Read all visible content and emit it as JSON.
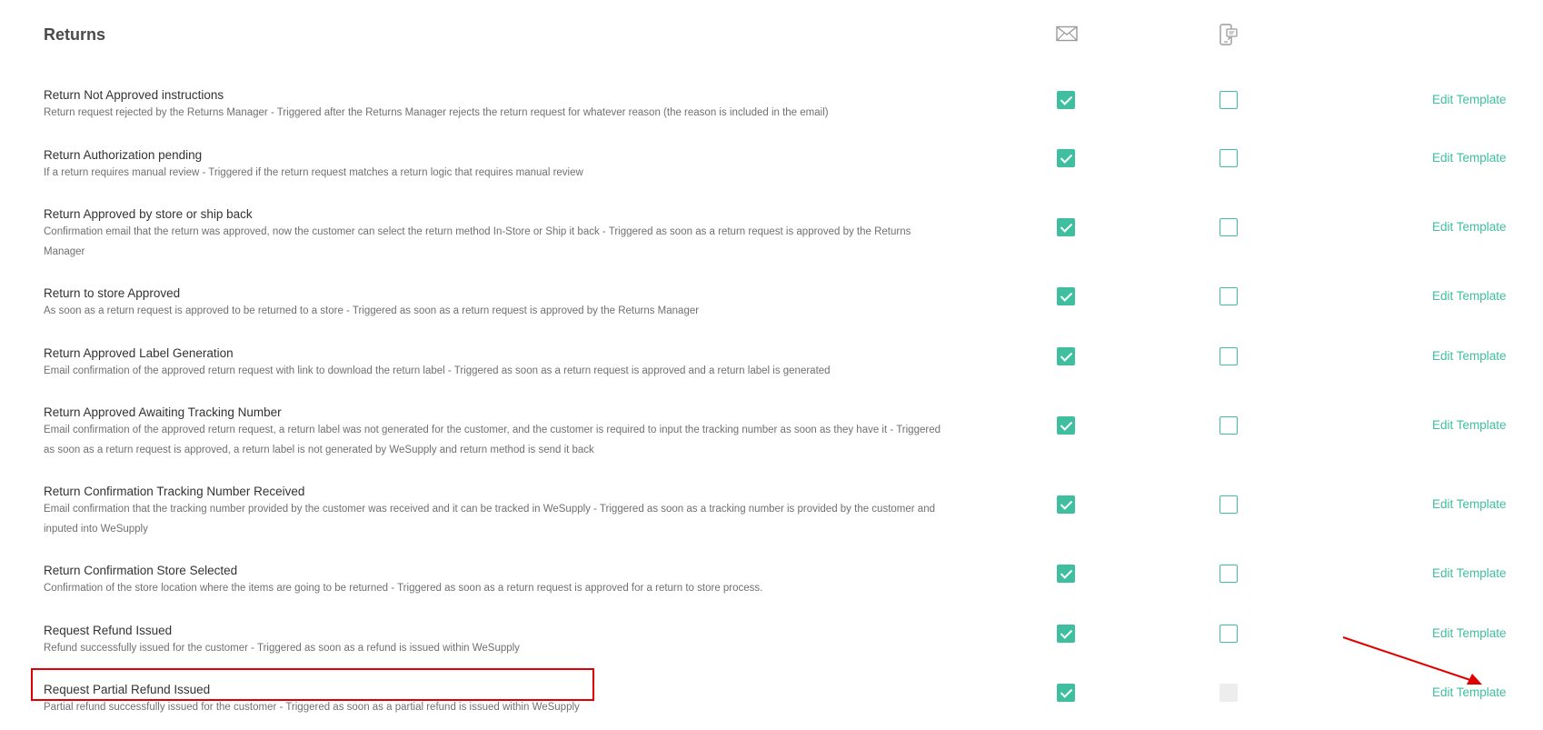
{
  "section": {
    "title": "Returns"
  },
  "header_icons": {
    "email": "envelope-icon",
    "sms": "mobile-chat-icon"
  },
  "colors": {
    "accent": "#3fbf9f",
    "highlight": "#e00000",
    "disabled": "#ededed"
  },
  "rows": [
    {
      "title": "Return Not Approved instructions",
      "desc_lines": [
        "Return request rejected by the Returns Manager - Triggered after the Returns Manager rejects the return request for whatever reason (the reason is included in the email)"
      ],
      "email": "checked",
      "sms": "empty",
      "action": "Edit Template"
    },
    {
      "title": "Return Authorization pending",
      "desc_lines": [
        "If a return requires manual review - Triggered if the return request matches a return logic that requires manual review"
      ],
      "email": "checked",
      "sms": "empty",
      "action": "Edit Template"
    },
    {
      "title": "Return Approved by store or ship back",
      "desc_lines": [
        "Confirmation email that the return was approved, now the customer can select the return method In-Store or Ship it back - Triggered as soon as a return request is approved by the Returns",
        "Manager"
      ],
      "email": "checked",
      "sms": "empty",
      "action": "Edit Template"
    },
    {
      "title": "Return to store Approved",
      "desc_lines": [
        "As soon as a return request is approved to be returned to a store - Triggered as soon as a return request is approved by the Returns Manager"
      ],
      "email": "checked",
      "sms": "empty",
      "action": "Edit Template"
    },
    {
      "title": "Return Approved Label Generation",
      "desc_lines": [
        "Email confirmation of the approved return request with link to download the return label - Triggered as soon as a return request is approved and a return label is generated"
      ],
      "email": "checked",
      "sms": "empty",
      "action": "Edit Template"
    },
    {
      "title": "Return Approved Awaiting Tracking Number",
      "desc_lines": [
        "Email confirmation of the approved return request, a return label was not generated for the customer, and the customer is required to input the tracking number as soon as they have it - Triggered",
        "as soon as a return request is approved, a return label is not generated by WeSupply and return method is send it back"
      ],
      "email": "checked",
      "sms": "empty",
      "action": "Edit Template"
    },
    {
      "title": "Return Confirmation Tracking Number Received",
      "desc_lines": [
        "Email confirmation that the tracking number provided by the customer was received and it can be tracked in WeSupply - Triggered as soon as a tracking number is provided by the customer and",
        "inputed into WeSupply"
      ],
      "email": "checked",
      "sms": "empty",
      "action": "Edit Template"
    },
    {
      "title": "Return Confirmation Store Selected",
      "desc_lines": [
        "Confirmation of the store location where the items are going to be returned - Triggered as soon as a return request is approved for a return to store process."
      ],
      "email": "checked",
      "sms": "empty",
      "action": "Edit Template"
    },
    {
      "title": "Request Refund Issued",
      "desc_lines": [
        "Refund successfully issued for the customer - Triggered as soon as a refund is issued within WeSupply"
      ],
      "email": "checked",
      "sms": "empty",
      "action": "Edit Template"
    },
    {
      "title": "Request Partial Refund Issued",
      "desc_lines": [
        "Partial refund successfully issued for the customer - Triggered as soon as a partial refund is issued within WeSupply"
      ],
      "email": "checked",
      "sms": "disabled",
      "action": "Edit Template",
      "highlighted": true
    }
  ]
}
